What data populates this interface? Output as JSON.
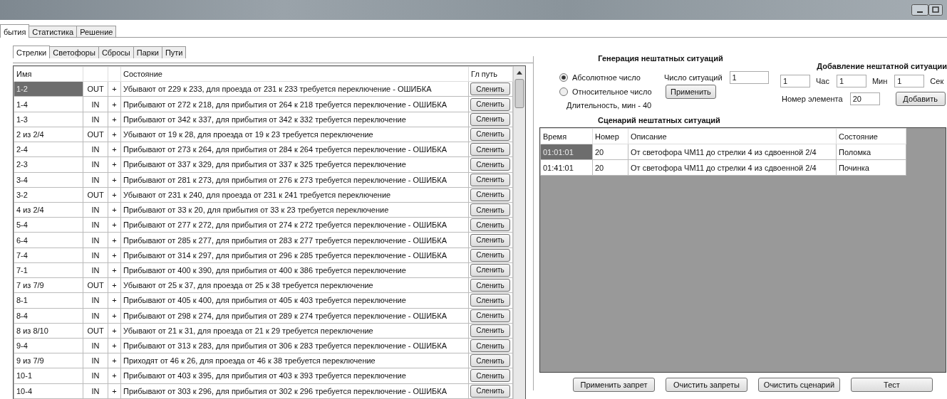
{
  "main_tabs": [
    {
      "label": "бытия",
      "selected": true
    },
    {
      "label": "Статистика",
      "selected": false
    },
    {
      "label": "Решение",
      "selected": false
    }
  ],
  "sub_tabs": [
    {
      "label": "Стрелки",
      "selected": true
    },
    {
      "label": "Светофоры",
      "selected": false
    },
    {
      "label": "Сбросы",
      "selected": false
    },
    {
      "label": "Парки",
      "selected": false
    },
    {
      "label": "Пути",
      "selected": false
    }
  ],
  "table": {
    "columns": {
      "name": "Имя",
      "state": "Состояние",
      "track": "Гл путь"
    },
    "rows": [
      {
        "name": "1-2",
        "dir": "OUT",
        "mark": "+",
        "state": "Убывают от 229 к 233, для проезда от 231 к 233 требуется переключение - ОШИБКА",
        "action": "Сленить",
        "selected": true
      },
      {
        "name": "1-4",
        "dir": "IN",
        "mark": "+",
        "state": "Прибывают от 272 к 218, для прибытия от 264 к 218 требуется переключение - ОШИБКА",
        "action": "Сленить",
        "selected": false
      },
      {
        "name": "1-3",
        "dir": "IN",
        "mark": "+",
        "state": "Прибывают от 342 к 337, для прибытия от 342 к 332 требуется переключение",
        "action": "Сленить",
        "selected": false
      },
      {
        "name": "2 из 2/4",
        "dir": "OUT",
        "mark": "+",
        "state": "Убывают от 19 к 28, для проезда от 19 к 23 требуется переключение",
        "action": "Сленить",
        "selected": false
      },
      {
        "name": "2-4",
        "dir": "IN",
        "mark": "+",
        "state": "Прибывают от 273 к 264, для прибытия от 284 к 264 требуется переключение - ОШИБКА",
        "action": "Сленить",
        "selected": false
      },
      {
        "name": "2-3",
        "dir": "IN",
        "mark": "+",
        "state": "Прибывают от 337 к 329, для прибытия от 337 к 325 требуется переключение",
        "action": "Сленить",
        "selected": false
      },
      {
        "name": "3-4",
        "dir": "IN",
        "mark": "+",
        "state": "Прибывают от 281 к 273, для прибытия от 276 к 273 требуется переключение - ОШИБКА",
        "action": "Сленить",
        "selected": false
      },
      {
        "name": "3-2",
        "dir": "OUT",
        "mark": "+",
        "state": "Убывают от 231 к 240, для проезда от 231 к 241 требуется переключение",
        "action": "Сленить",
        "selected": false
      },
      {
        "name": "4 из 2/4",
        "dir": "IN",
        "mark": "+",
        "state": "Прибывают от 33 к 20, для прибытия от 33 к 23 требуется переключение",
        "action": "Сленить",
        "selected": false
      },
      {
        "name": "5-4",
        "dir": "IN",
        "mark": "+",
        "state": "Прибывают от 277 к 272, для прибытия от 274 к 272 требуется переключение - ОШИБКА",
        "action": "Сленить",
        "selected": false
      },
      {
        "name": "6-4",
        "dir": "IN",
        "mark": "+",
        "state": "Прибывают от 285 к 277, для прибытия от 283 к 277 требуется переключение - ОШИБКА",
        "action": "Сленить",
        "selected": false
      },
      {
        "name": "7-4",
        "dir": "IN",
        "mark": "+",
        "state": "Прибывают от 314 к 297, для прибытия от 296 к 285 требуется переключение - ОШИБКА",
        "action": "Сленить",
        "selected": false
      },
      {
        "name": "7-1",
        "dir": "IN",
        "mark": "+",
        "state": "Прибывают от 400 к 390, для прибытия от 400 к 386 требуется переключение",
        "action": "Сленить",
        "selected": false
      },
      {
        "name": "7 из 7/9",
        "dir": "OUT",
        "mark": "+",
        "state": "Убывают от 25 к 37, для проезда от 25 к 38 требуется переключение",
        "action": "Сленить",
        "selected": false
      },
      {
        "name": "8-1",
        "dir": "IN",
        "mark": "+",
        "state": "Прибывают от 405 к 400, для прибытия от 405 к 403 требуется переключение",
        "action": "Сленить",
        "selected": false
      },
      {
        "name": "8-4",
        "dir": "IN",
        "mark": "+",
        "state": "Прибывают от 298 к 274, для прибытия от 289 к 274 требуется переключение - ОШИБКА",
        "action": "Сленить",
        "selected": false
      },
      {
        "name": "8 из 8/10",
        "dir": "OUT",
        "mark": "+",
        "state": "Убывают от 21 к 31, для проезда от 21 к 29 требуется переключение",
        "action": "Сленить",
        "selected": false
      },
      {
        "name": "9-4",
        "dir": "IN",
        "mark": "+",
        "state": "Прибывают от 313 к 283, для прибытия от 306 к 283 требуется переключение - ОШИБКА",
        "action": "Сленить",
        "selected": false
      },
      {
        "name": "9 из 7/9",
        "dir": "IN",
        "mark": "+",
        "state": "Приходят от 46 к 26, для проезда от 46 к 38 требуется переключение",
        "action": "Сленить",
        "selected": false
      },
      {
        "name": "10-1",
        "dir": "IN",
        "mark": "+",
        "state": "Прибывают от 403 к 395, для прибытия от 403 к 393 требуется переключение",
        "action": "Сленить",
        "selected": false
      },
      {
        "name": "10-4",
        "dir": "IN",
        "mark": "+",
        "state": "Прибывают от 303 к 296, для прибытия от 302 к 296 требуется переключение - ОШИБКА",
        "action": "Сленить",
        "selected": false
      }
    ]
  },
  "generation": {
    "title": "Генерация нештатных ситуаций",
    "modes": [
      {
        "label": "Абсолютное число",
        "selected": true
      },
      {
        "label": "Относительное число",
        "selected": false
      }
    ],
    "duration": "Длительность, мин - 40",
    "count_label": "Число ситуаций",
    "count": "1",
    "apply": "Применить"
  },
  "add": {
    "title": "Добавление нештатной ситуации",
    "time": [
      {
        "value": "1",
        "unit": "Час"
      },
      {
        "value": "1",
        "unit": "Мин"
      },
      {
        "value": "1",
        "unit": "Сек"
      }
    ],
    "element_label": "Номер элемента",
    "element": "20",
    "button": "Добавить"
  },
  "scenario": {
    "title": "Сценарий нештатных ситуаций",
    "columns": [
      "Время",
      "Номер",
      "Описание",
      "Состояние"
    ],
    "rows": [
      {
        "time": "01:01:01",
        "number": "20",
        "description": "От светофора ЧМ11 до стрелки 4 из сдвоенной 2/4",
        "state": "Поломка",
        "selected": true
      },
      {
        "time": "01:41:01",
        "number": "20",
        "description": "От светофора ЧМ11 до стрелки 4 из сдвоенной 2/4",
        "state": "Починка",
        "selected": false
      }
    ]
  },
  "actions": [
    "Применить запрет",
    "Очистить запреты",
    "Очистить сценарий",
    "Тест"
  ]
}
